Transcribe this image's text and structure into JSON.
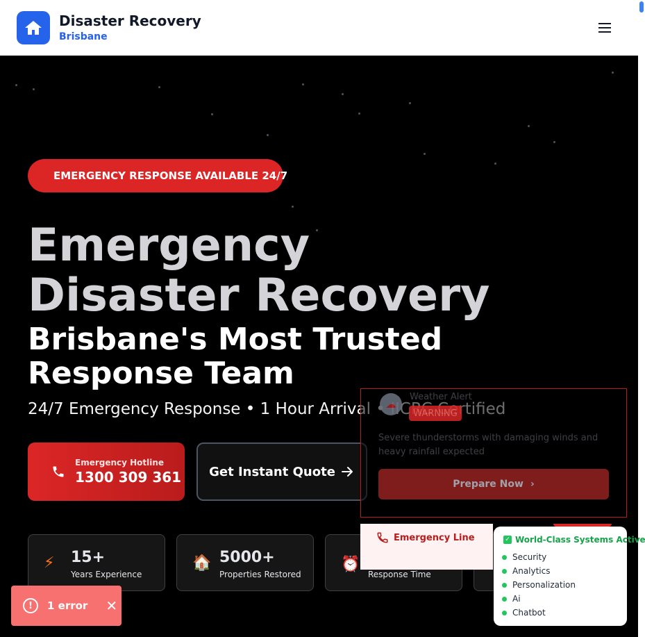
{
  "header": {
    "title": "Disaster Recovery",
    "location": "Brisbane",
    "logo_icon": "home-icon",
    "menu_icon": "hamburger-menu-icon"
  },
  "hero": {
    "badge": "EMERGENCY RESPONSE AVAILABLE 24/7",
    "headline": "Emergency Disaster Recovery",
    "subheadline": "Brisbane's Most Trusted Response Team",
    "tagline": "24/7 Emergency Response • 1 Hour Arrival • IICRC Certified",
    "hotline": {
      "label": "Emergency Hotline",
      "number": "1300 309 361",
      "icon": "phone-icon"
    },
    "quote_button": {
      "label": "Get Instant Quote",
      "icon": "arrow-right-icon"
    }
  },
  "stats": [
    {
      "value": "15+",
      "label": "Years Experience",
      "icon": "lightning-icon"
    },
    {
      "value": "5000+",
      "label": "Properties Restored",
      "icon": "house-icon"
    },
    {
      "value": "",
      "label": "Response Time",
      "icon": "alarm-clock-icon"
    }
  ],
  "weather_alert": {
    "title": "Weather Alert",
    "badge": "WARNING",
    "description": "Severe thunderstorms with damaging winds and heavy rainfall expected",
    "button": "Prepare Now"
  },
  "emergency_line": {
    "label": "Emergency Line",
    "icon": "phone-icon"
  },
  "systems": {
    "title": "World-Class Systems Active",
    "items": [
      "Security",
      "Analytics",
      "Personalization",
      "Ai",
      "Chatbot"
    ]
  },
  "error_toast": {
    "label": "1 error"
  },
  "colors": {
    "primary_blue": "#2563eb",
    "emergency_red": "#dc2626",
    "status_green": "#22c55e"
  }
}
